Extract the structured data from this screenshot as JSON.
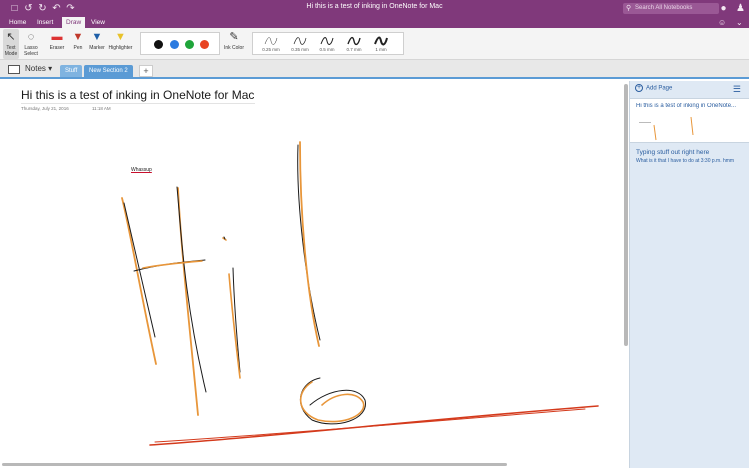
{
  "window": {
    "title": "Hi this is a test of inking in OneNote for Mac",
    "search_placeholder": "Search All Notebooks"
  },
  "titlebar_icons": [
    "folder-icon",
    "back-icon",
    "forward-icon",
    "undo-icon",
    "redo-icon"
  ],
  "menu_tabs": [
    {
      "label": "Home",
      "active": false
    },
    {
      "label": "Insert",
      "active": false
    },
    {
      "label": "Draw",
      "active": true
    },
    {
      "label": "View",
      "active": false
    }
  ],
  "ribbon": {
    "tools": [
      {
        "label": "Text\nMode",
        "icon": "text-mode-icon",
        "selected": true
      },
      {
        "label": "Lasso\nSelect",
        "icon": "lasso-icon",
        "selected": false
      },
      {
        "label": "Eraser",
        "icon": "eraser-icon",
        "selected": false
      },
      {
        "label": "Pen",
        "icon": "pen-icon",
        "selected": false
      },
      {
        "label": "Marker",
        "icon": "marker-icon",
        "selected": false
      },
      {
        "label": "Highlighter",
        "icon": "highlighter-icon",
        "selected": false
      }
    ],
    "colors": [
      "#111111",
      "#2b7be0",
      "#1fa53a",
      "#e84422"
    ],
    "ink_color_label": "Ink Color",
    "strokes": [
      "0.25 mm",
      "0.35 mm",
      "0.5 mm",
      "0.7 mm",
      "1 mm"
    ]
  },
  "notebook": {
    "name": "Notes",
    "sections": [
      {
        "label": "Stuff",
        "color": "#7fb3e0"
      },
      {
        "label": "New Section 2",
        "color": "#5b9bd5"
      }
    ]
  },
  "page": {
    "title": "Hi this is a test of inking in OneNote for Mac",
    "date": "Thursday, July 21, 2016",
    "time": "11:18 AM",
    "handwriting_text": "Whassup"
  },
  "sidebar": {
    "add_page_label": "Add Page",
    "pages": [
      {
        "title": "Hi this is a test of inking in OneNote..."
      },
      {
        "title": "Typing stuff out right here",
        "preview": "What is it that I have to do at 3:30 p.m. hmm"
      }
    ]
  },
  "ink_colors": {
    "black": "#1a1a1a",
    "orange": "#e8963a",
    "red": "#d43a1c"
  }
}
